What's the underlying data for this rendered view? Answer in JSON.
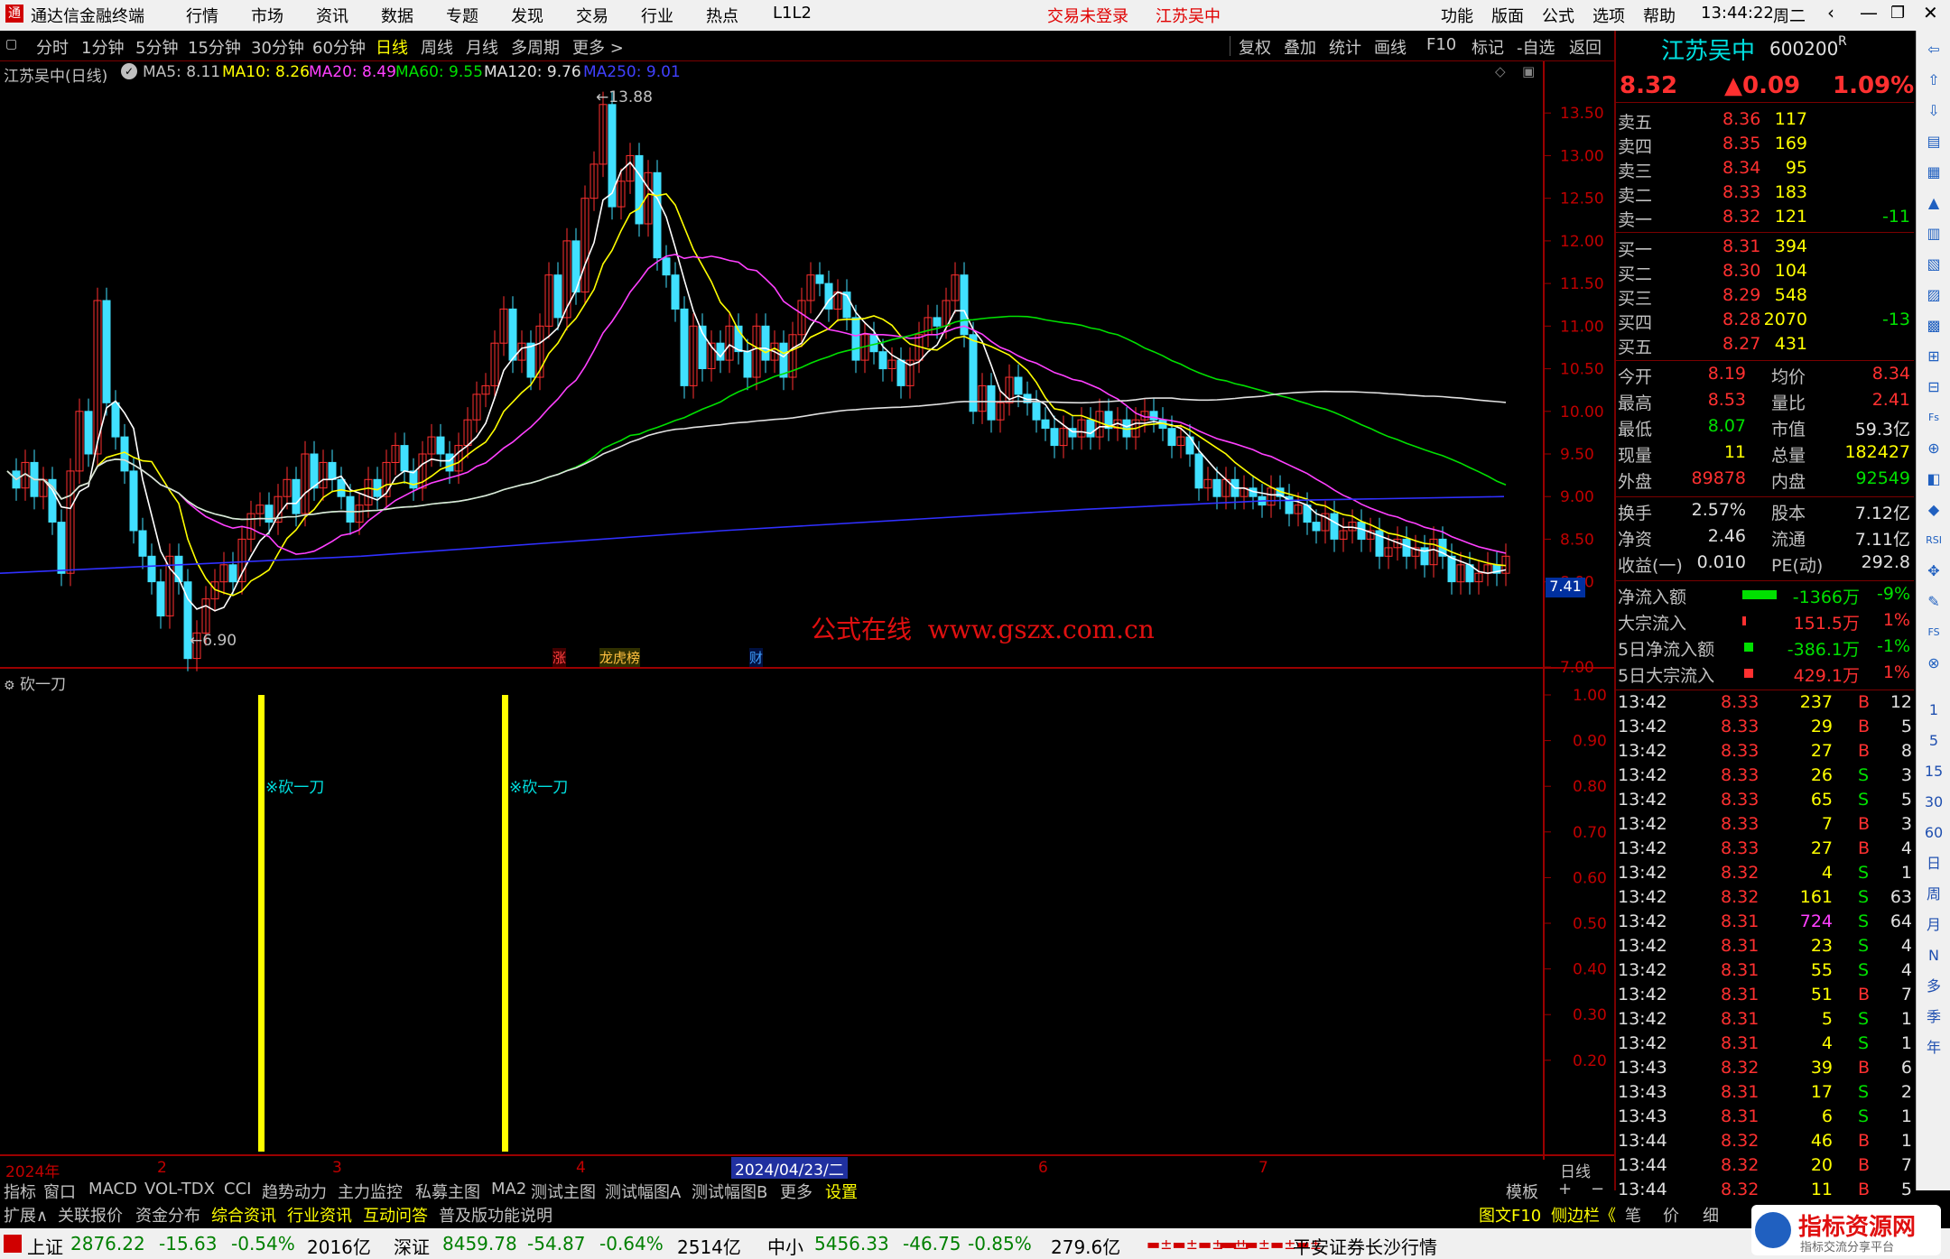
{
  "app": {
    "title": "通达信金融终端",
    "login_status": "交易未登录",
    "stock_name_header": "江苏吴中",
    "time": "13:44:22",
    "weekday": "周二",
    "level": "L1L2"
  },
  "menu": [
    "行情",
    "市场",
    "资讯",
    "数据",
    "专题",
    "发现",
    "交易",
    "行业",
    "热点"
  ],
  "menu_right": [
    "功能",
    "版面",
    "公式",
    "选项",
    "帮助"
  ],
  "timeframes": [
    "分时",
    "1分钟",
    "5分钟",
    "15分钟",
    "30分钟",
    "60分钟",
    "日线",
    "周线",
    "月线",
    "多周期",
    "更多 >"
  ],
  "tf_active_index": 6,
  "chart_tools": [
    "复权",
    "叠加",
    "统计",
    "画线",
    "F10",
    "标记",
    "-自选",
    "返回"
  ],
  "main_chart": {
    "title": "江苏吴中(日线)",
    "ma": [
      {
        "label": "MA5: 8.11",
        "color": "#ffffff"
      },
      {
        "label": "MA10: 8.26",
        "color": "#ffff00"
      },
      {
        "label": "MA20: 8.49",
        "color": "#ff40ff"
      },
      {
        "label": "MA60: 9.55",
        "color": "#00e000"
      },
      {
        "label": "MA120: 9.76",
        "color": "#e0e0e0"
      },
      {
        "label": "MA250: 9.01",
        "color": "#4040ff"
      }
    ],
    "high_label": "13.88",
    "low_label": "6.90",
    "price_ticks": [
      "13.50",
      "13.00",
      "12.50",
      "12.00",
      "11.50",
      "11.00",
      "10.50",
      "10.00",
      "9.50",
      "9.00",
      "8.50",
      "8.00",
      "7.41",
      "7.00"
    ],
    "current_tag": "7.41",
    "watermark": "公式在线  www.gszx.com.cn",
    "markers": [
      "涨",
      "龙虎榜",
      "财"
    ]
  },
  "sub_chart": {
    "title": "砍一刀",
    "signal_label": "※砍一刀",
    "ticks": [
      "1.00",
      "0.90",
      "0.80",
      "0.70",
      "0.60",
      "0.50",
      "0.40",
      "0.30",
      "0.20"
    ]
  },
  "date_axis": {
    "labels": [
      "2024年",
      "2",
      "3",
      "4",
      "2024/04/23/二",
      "6",
      "7"
    ],
    "period": "日线"
  },
  "tabs1": [
    "指标",
    "窗口",
    "MACD",
    "VOL-TDX",
    "CCI",
    "趋势动力",
    "主力监控",
    "私募主图",
    "MA2",
    "测试主图",
    "测试幅图A",
    "测试幅图B",
    "更多",
    "设置"
  ],
  "tabs1_right": [
    "模板",
    "+",
    "−"
  ],
  "tabs2": [
    "扩展∧",
    "关联报价",
    "资金分布",
    "综合资讯",
    "行业资讯",
    "互动问答",
    "普及版功能说明"
  ],
  "tabs2_right": [
    "图文F10",
    "侧边栏《",
    "笔",
    "价",
    "细"
  ],
  "quote": {
    "name": "江苏吴中",
    "code": "600200",
    "flag": "R",
    "price": "8.32",
    "change": "▲0.09",
    "pct": "1.09%",
    "asks": [
      {
        "label": "卖五",
        "price": "8.36",
        "vol": "117",
        "chg": ""
      },
      {
        "label": "卖四",
        "price": "8.35",
        "vol": "169",
        "chg": ""
      },
      {
        "label": "卖三",
        "price": "8.34",
        "vol": "95",
        "chg": ""
      },
      {
        "label": "卖二",
        "price": "8.33",
        "vol": "183",
        "chg": ""
      },
      {
        "label": "卖一",
        "price": "8.32",
        "vol": "121",
        "chg": "-11"
      }
    ],
    "bids": [
      {
        "label": "买一",
        "price": "8.31",
        "vol": "394",
        "chg": ""
      },
      {
        "label": "买二",
        "price": "8.30",
        "vol": "104",
        "chg": ""
      },
      {
        "label": "买三",
        "price": "8.29",
        "vol": "548",
        "chg": ""
      },
      {
        "label": "买四",
        "price": "8.28",
        "vol": "2070",
        "chg": "-13"
      },
      {
        "label": "买五",
        "price": "8.27",
        "vol": "431",
        "chg": ""
      }
    ],
    "stats": [
      [
        {
          "k": "今开",
          "v": "8.19"
        },
        {
          "k": "均价",
          "v": "8.34"
        }
      ],
      [
        {
          "k": "最高",
          "v": "8.53"
        },
        {
          "k": "量比",
          "v": "2.41"
        }
      ],
      [
        {
          "k": "最低",
          "v": "8.07"
        },
        {
          "k": "市值",
          "v": "59.3亿"
        }
      ],
      [
        {
          "k": "现量",
          "v": "11"
        },
        {
          "k": "总量",
          "v": "182427"
        }
      ],
      [
        {
          "k": "外盘",
          "v": "89878"
        },
        {
          "k": "内盘",
          "v": "92549"
        }
      ]
    ],
    "stats2": [
      [
        {
          "k": "换手",
          "v": "2.57%"
        },
        {
          "k": "股本",
          "v": "7.12亿"
        }
      ],
      [
        {
          "k": "净资",
          "v": "2.46"
        },
        {
          "k": "流通",
          "v": "7.11亿"
        }
      ],
      [
        {
          "k": "收益(一)",
          "v": "0.010"
        },
        {
          "k": "PE(动)",
          "v": "292.8"
        }
      ]
    ],
    "flows": [
      {
        "k": "净流入额",
        "v": "-1366万",
        "p": "-9%"
      },
      {
        "k": "大宗流入",
        "v": "151.5万",
        "p": "1%"
      },
      {
        "k": "5日净流入额",
        "v": "-386.1万",
        "p": "-1%"
      },
      {
        "k": "5日大宗流入",
        "v": "429.1万",
        "p": "1%"
      }
    ],
    "ticks": [
      [
        "13:42",
        "8.33",
        "237",
        "B",
        "12"
      ],
      [
        "13:42",
        "8.33",
        "29",
        "B",
        "5"
      ],
      [
        "13:42",
        "8.33",
        "27",
        "B",
        "8"
      ],
      [
        "13:42",
        "8.33",
        "26",
        "S",
        "3"
      ],
      [
        "13:42",
        "8.33",
        "65",
        "S",
        "5"
      ],
      [
        "13:42",
        "8.33",
        "7",
        "B",
        "3"
      ],
      [
        "13:42",
        "8.33",
        "27",
        "B",
        "4"
      ],
      [
        "13:42",
        "8.32",
        "4",
        "S",
        "1"
      ],
      [
        "13:42",
        "8.32",
        "161",
        "S",
        "63"
      ],
      [
        "13:42",
        "8.31",
        "724",
        "S",
        "64"
      ],
      [
        "13:42",
        "8.31",
        "23",
        "S",
        "4"
      ],
      [
        "13:42",
        "8.31",
        "55",
        "S",
        "4"
      ],
      [
        "13:42",
        "8.31",
        "51",
        "B",
        "7"
      ],
      [
        "13:42",
        "8.31",
        "5",
        "S",
        "1"
      ],
      [
        "13:42",
        "8.31",
        "4",
        "S",
        "1"
      ],
      [
        "13:43",
        "8.32",
        "39",
        "B",
        "6"
      ],
      [
        "13:43",
        "8.31",
        "17",
        "S",
        "2"
      ],
      [
        "13:43",
        "8.31",
        "6",
        "S",
        "1"
      ],
      [
        "13:44",
        "8.32",
        "46",
        "B",
        "1"
      ],
      [
        "13:44",
        "8.32",
        "20",
        "B",
        "7"
      ],
      [
        "13:44",
        "8.32",
        "11",
        "B",
        "5"
      ]
    ]
  },
  "sidebar_labels": [
    "1",
    "5",
    "15",
    "30",
    "60",
    "日",
    "周",
    "月",
    "N",
    "多",
    "季",
    "年"
  ],
  "status": {
    "sh_name": "上证",
    "sh_val": "2876.22",
    "sh_chg": "-15.63",
    "sh_pct": "-0.54%",
    "sh_amt": "2016亿",
    "sz_name": "深证",
    "sz_val": "8459.78",
    "sz_chg": "-54.87",
    "sz_pct": "-0.64%",
    "sz_amt": "2514亿",
    "zx_name": "中小",
    "zx_val": "5456.33",
    "zx_chg": "-46.75",
    "zx_pct": "-0.85%",
    "zx_amt": "279.6亿",
    "broker": "平安证券长沙行情",
    "logo_title": "指标资源网",
    "logo_sub": "指标交流分享平台"
  }
}
